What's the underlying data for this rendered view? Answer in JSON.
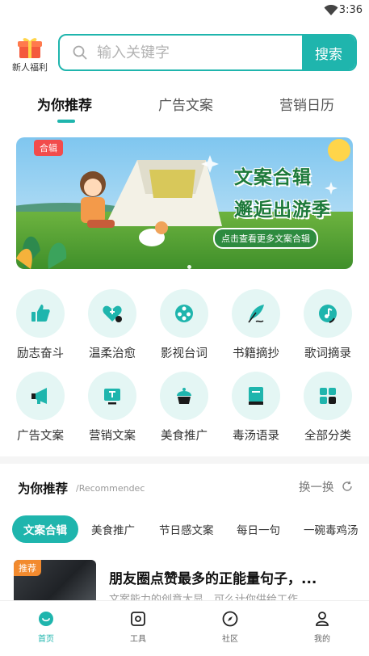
{
  "status_bar": {
    "time": "3:36"
  },
  "header": {
    "gift_label": "新人福利",
    "search_placeholder": "输入关键字",
    "search_button": "搜索"
  },
  "tabs": [
    {
      "label": "为你推荐",
      "active": true
    },
    {
      "label": "广告文案",
      "active": false
    },
    {
      "label": "营销日历",
      "active": false
    }
  ],
  "banner": {
    "tag": "合辑",
    "title_line1": "文案合辑",
    "title_line2": "邂逅出游季",
    "cta": "点击查看更多文案合辑"
  },
  "categories": [
    {
      "label": "励志奋斗",
      "icon": "thumbs-up-icon"
    },
    {
      "label": "温柔治愈",
      "icon": "heart-plus-icon"
    },
    {
      "label": "影视台词",
      "icon": "film-reel-icon"
    },
    {
      "label": "书籍摘抄",
      "icon": "feather-pen-icon"
    },
    {
      "label": "歌词摘录",
      "icon": "music-disc-icon"
    },
    {
      "label": "广告文案",
      "icon": "megaphone-icon"
    },
    {
      "label": "营销文案",
      "icon": "monitor-t-icon"
    },
    {
      "label": "美食推广",
      "icon": "cake-icon"
    },
    {
      "label": "毒汤语录",
      "icon": "book-icon"
    },
    {
      "label": "全部分类",
      "icon": "grid-icon"
    }
  ],
  "recommend": {
    "title": "为你推荐",
    "subtitle": "/Recommendec",
    "refresh": "换一换"
  },
  "chips": [
    {
      "label": "文案合辑",
      "active": true
    },
    {
      "label": "美食推广",
      "active": false
    },
    {
      "label": "节日感文案",
      "active": false
    },
    {
      "label": "每日一句",
      "active": false
    },
    {
      "label": "一碗毒鸡汤",
      "active": false
    }
  ],
  "article": {
    "tag": "推荐",
    "title": "朋友圈点赞最多的正能量句子，...",
    "subtitle": "文案能力的创意大显，可么计你供给工作..."
  },
  "bottom_nav": [
    {
      "label": "首页",
      "icon": "home-icon",
      "active": true
    },
    {
      "label": "工具",
      "icon": "tools-icon",
      "active": false
    },
    {
      "label": "社区",
      "icon": "compass-icon",
      "active": false
    },
    {
      "label": "我的",
      "icon": "user-icon",
      "active": false
    }
  ],
  "colors": {
    "accent": "#1fb5ad",
    "accent_light": "#e4f6f4",
    "tag_red": "#f24c4c",
    "tag_orange": "#f28a2e"
  }
}
